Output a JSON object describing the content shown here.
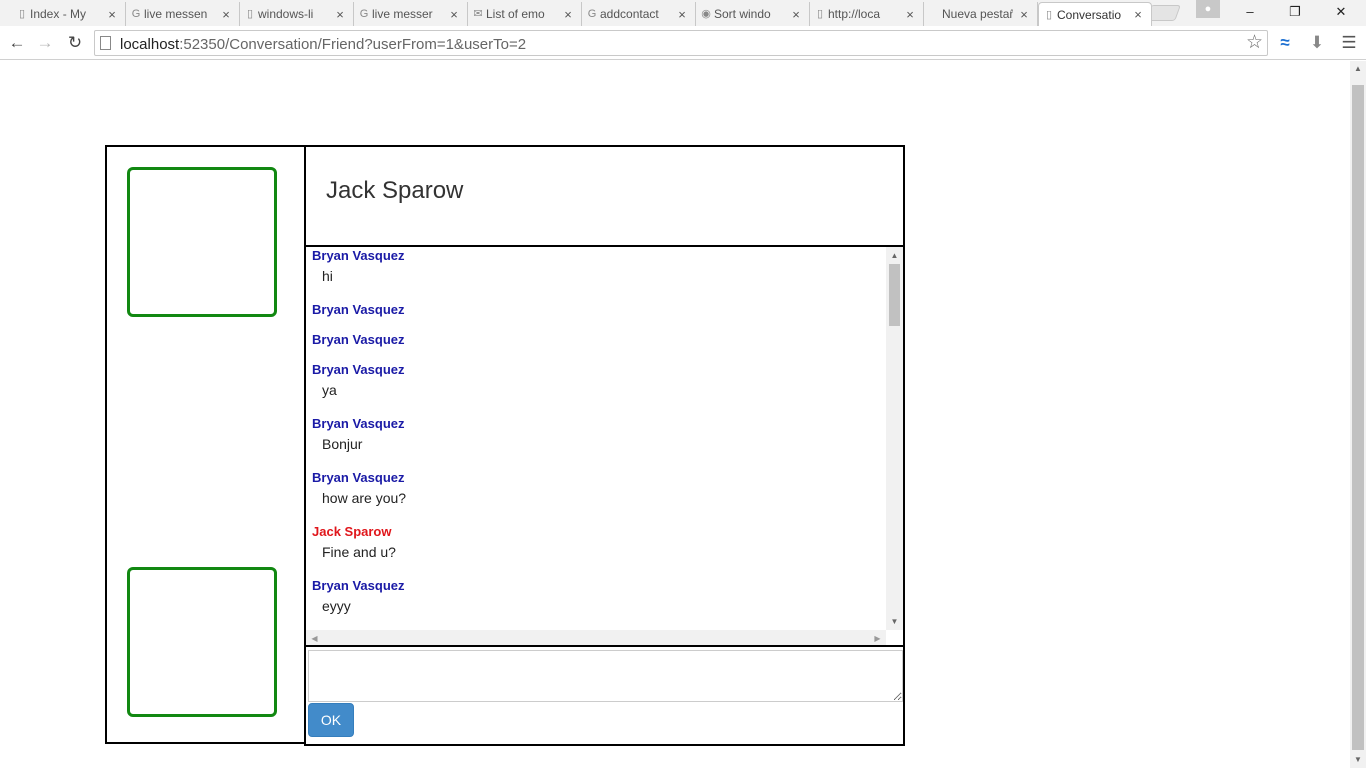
{
  "browser": {
    "tabs": [
      {
        "title": "Index - My",
        "icon": "page"
      },
      {
        "title": "live messen",
        "icon": "google"
      },
      {
        "title": "windows-li",
        "icon": "page"
      },
      {
        "title": "live messer",
        "icon": "google"
      },
      {
        "title": "List of emo",
        "icon": "mail"
      },
      {
        "title": "addcontact",
        "icon": "google"
      },
      {
        "title": "Sort windo",
        "icon": "eye"
      },
      {
        "title": "http://loca",
        "icon": "page"
      },
      {
        "title": "Nueva pestaña",
        "icon": "none"
      },
      {
        "title": "Conversatio",
        "icon": "page",
        "active": true
      }
    ],
    "url_host": "localhost",
    "url_rest": ":52350/Conversation/Friend?userFrom=1&userTo=2",
    "tab_close_glyph": "×",
    "window_buttons": {
      "minimize": "–",
      "restore": "❐",
      "close": "✕"
    }
  },
  "conversation": {
    "friend_name": "Jack Sparow",
    "messages": [
      {
        "sender": "Bryan Vasquez",
        "text": "hi",
        "is_me": true
      },
      {
        "sender": "Bryan Vasquez",
        "text": "",
        "is_me": true
      },
      {
        "sender": "Bryan Vasquez",
        "text": "",
        "is_me": true
      },
      {
        "sender": "Bryan Vasquez",
        "text": "ya",
        "is_me": true
      },
      {
        "sender": "Bryan Vasquez",
        "text": "Bonjur",
        "is_me": true
      },
      {
        "sender": "Bryan Vasquez",
        "text": "how are you?",
        "is_me": true
      },
      {
        "sender": "Jack Sparow",
        "text": "Fine and u?",
        "is_me": false
      },
      {
        "sender": "Bryan Vasquez",
        "text": "eyyy",
        "is_me": true
      }
    ],
    "input_value": "",
    "send_label": "OK"
  },
  "colors": {
    "me_sender": "#1a1aa6",
    "friend_sender": "#e0161b",
    "avatar_border": "#118811",
    "button": "#428bca"
  }
}
